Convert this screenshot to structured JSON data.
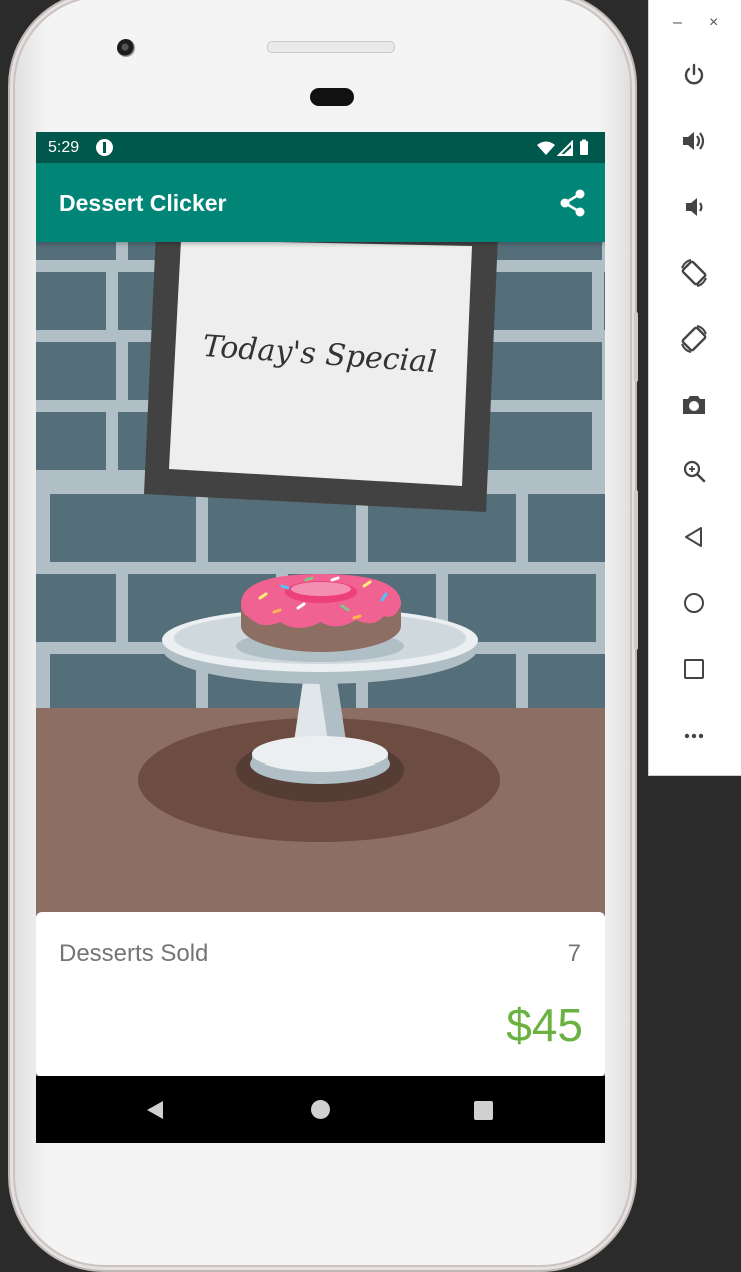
{
  "status_bar": {
    "time": "5:29"
  },
  "app_bar": {
    "title": "Dessert Clicker"
  },
  "scene": {
    "sign_text": "Today's Special"
  },
  "info": {
    "desserts_sold_label": "Desserts Sold",
    "desserts_sold_count": "7",
    "revenue": "$45"
  },
  "emulator": {
    "minimize_label": "–",
    "close_label": "×",
    "tools": [
      "power-icon",
      "volume-up-icon",
      "volume-down-icon",
      "rotate-left-icon",
      "rotate-right-icon",
      "camera-icon",
      "zoom-icon",
      "back-icon",
      "home-icon",
      "overview-icon",
      "more-icon"
    ]
  },
  "colors": {
    "status_bar": "#00574b",
    "app_bar": "#008577",
    "revenue": "#6ab343",
    "wall": "#546e7a",
    "table": "#8c6e62",
    "donut_icing": "#f06292"
  }
}
